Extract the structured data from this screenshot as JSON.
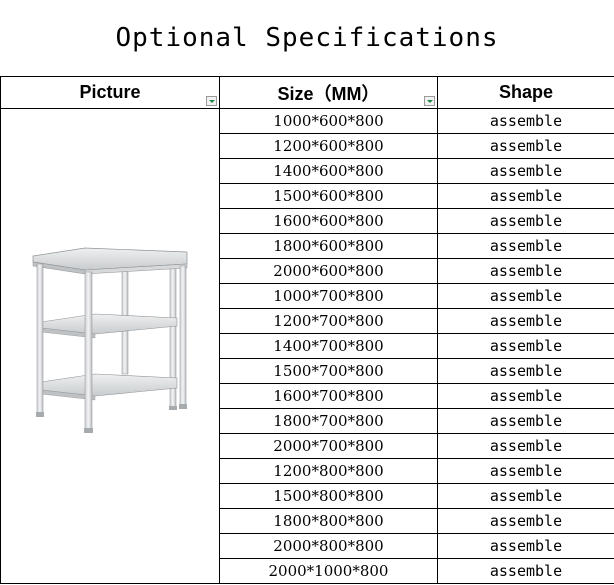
{
  "title": "Optional Specifications",
  "headers": {
    "picture": "Picture",
    "size": "Size（MM）",
    "shape": "Shape"
  },
  "rows": [
    {
      "size": "1000*600*800",
      "shape": "assemble"
    },
    {
      "size": "1200*600*800",
      "shape": "assemble"
    },
    {
      "size": "1400*600*800",
      "shape": "assemble"
    },
    {
      "size": "1500*600*800",
      "shape": "assemble"
    },
    {
      "size": "1600*600*800",
      "shape": "assemble"
    },
    {
      "size": "1800*600*800",
      "shape": "assemble"
    },
    {
      "size": "2000*600*800",
      "shape": "assemble"
    },
    {
      "size": "1000*700*800",
      "shape": "assemble"
    },
    {
      "size": "1200*700*800",
      "shape": "assemble"
    },
    {
      "size": "1400*700*800",
      "shape": "assemble"
    },
    {
      "size": "1500*700*800",
      "shape": "assemble"
    },
    {
      "size": "1600*700*800",
      "shape": "assemble"
    },
    {
      "size": "1800*700*800",
      "shape": "assemble"
    },
    {
      "size": "2000*700*800",
      "shape": "assemble"
    },
    {
      "size": "1200*800*800",
      "shape": "assemble"
    },
    {
      "size": "1500*800*800",
      "shape": "assemble"
    },
    {
      "size": "1800*800*800",
      "shape": "assemble"
    },
    {
      "size": "2000*800*800",
      "shape": "assemble"
    },
    {
      "size": "2000*1000*800",
      "shape": "assemble"
    }
  ],
  "picture_icon": "stainless-steel-table-icon"
}
